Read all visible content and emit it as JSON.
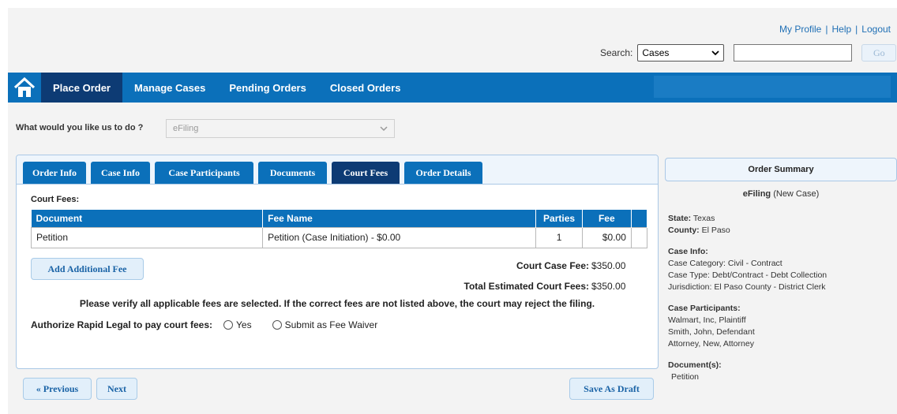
{
  "top_links": {
    "profile": "My Profile",
    "help": "Help",
    "logout": "Logout",
    "separator": "|"
  },
  "search": {
    "label": "Search:",
    "selected": "Cases",
    "input_value": "",
    "go_label": "Go"
  },
  "nav": {
    "items": [
      {
        "label": "Place Order",
        "active": true
      },
      {
        "label": "Manage Cases",
        "active": false
      },
      {
        "label": "Pending Orders",
        "active": false
      },
      {
        "label": "Closed Orders",
        "active": false
      }
    ]
  },
  "task": {
    "question": "What would you like us to do ?",
    "selected": "eFiling"
  },
  "tabs": [
    {
      "label": "Order Info"
    },
    {
      "label": "Case Info"
    },
    {
      "label": "Case Participants"
    },
    {
      "label": "Documents"
    },
    {
      "label": "Court Fees",
      "active": true
    },
    {
      "label": "Order Details"
    }
  ],
  "court_fees": {
    "section_label": "Court Fees:",
    "columns": [
      "Document",
      "Fee Name",
      "Parties",
      "Fee"
    ],
    "rows": [
      {
        "document": "Petition",
        "fee_name": "Petition (Case Initiation) - $0.00",
        "parties": "1",
        "fee": "$0.00"
      }
    ],
    "add_fee_label": "Add Additional Fee",
    "court_case_fee_label": "Court Case Fee:",
    "court_case_fee_value": "$350.00",
    "total_label": "Total Estimated Court Fees:",
    "total_value": "$350.00",
    "verify_note": "Please verify all applicable fees are selected. If the correct fees are not listed above, the court may reject the filing.",
    "authorize_label": "Authorize Rapid Legal to pay court fees:",
    "option_yes": "Yes",
    "option_waiver": "Submit as Fee Waiver"
  },
  "buttons": {
    "previous": "« Previous",
    "next": "Next",
    "save_draft": "Save As Draft"
  },
  "summary": {
    "header": "Order Summary",
    "title_bold": "eFiling",
    "title_rest": " (New Case)",
    "state_label": "State:",
    "state_value": " Texas",
    "county_label": "County:",
    "county_value": " El Paso",
    "case_info_label": "Case Info:",
    "case_info": [
      "Case Category: Civil - Contract",
      "Case Type: Debt/Contract - Debt Collection",
      "Jurisdiction: El Paso County - District Clerk"
    ],
    "participants_label": "Case Participants:",
    "participants": [
      "Walmart, Inc, Plaintiff",
      "Smith, John, Defendant",
      "Attorney, New, Attorney"
    ],
    "documents_label": "Document(s):",
    "documents": [
      "Petition"
    ]
  },
  "colors": {
    "nav_blue": "#0b70ba",
    "active_navy": "#0d3b74",
    "link_blue": "#1f6fb5"
  }
}
